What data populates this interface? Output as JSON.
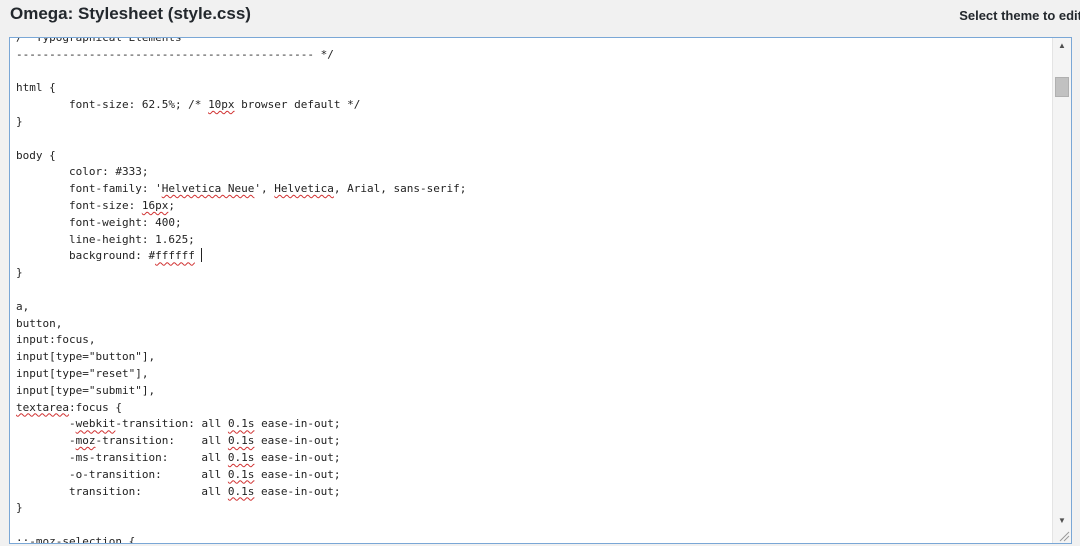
{
  "header": {
    "title": "Omega: Stylesheet (style.css)",
    "select_theme_label": "Select theme to edit"
  },
  "editor": {
    "lines": [
      "/* Typographical Elements",
      "--------------------------------------------- */",
      "",
      "html {",
      "        font-size: 62.5%; /* 10px browser default */",
      "}",
      "",
      "body {",
      "        color: #333;",
      "        font-family: 'Helvetica Neue', Helvetica, Arial, sans-serif;",
      "        font-size: 16px;",
      "        font-weight: 400;",
      "        line-height: 1.625;",
      "        background: #ffffff",
      "}",
      "",
      "a,",
      "button,",
      "input:focus,",
      "input[type=\"button\"],",
      "input[type=\"reset\"],",
      "input[type=\"submit\"],",
      "textarea:focus {",
      "        -webkit-transition: all 0.1s ease-in-out;",
      "        -moz-transition:    all 0.1s ease-in-out;",
      "        -ms-transition:     all 0.1s ease-in-out;",
      "        -o-transition:      all 0.1s ease-in-out;",
      "        transition:         all 0.1s ease-in-out;",
      "}",
      "",
      "::-moz-selection {"
    ],
    "spellcheck_words": [
      "10px",
      "Helvetica Neue",
      "Helvetica",
      "16px",
      "ffffff",
      "textarea",
      "webkit",
      "moz",
      "0.1s"
    ]
  },
  "icons": {
    "scroll_up": "triangle-up-icon",
    "scroll_down": "triangle-down-icon",
    "resize": "resize-grip-icon"
  }
}
